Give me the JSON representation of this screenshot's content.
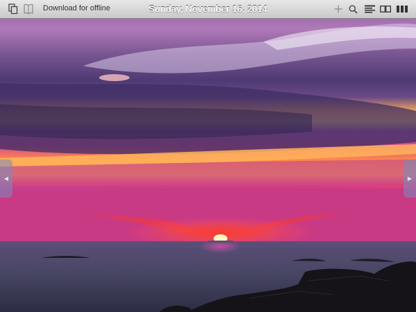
{
  "toolbar": {
    "download_label": "Download for offline",
    "date_title": "Sunday, November 16, 2014",
    "icons": {
      "left": [
        "pages-icon",
        "bookmark-icon"
      ],
      "right": [
        "add-icon",
        "search-icon",
        "list-icon",
        "two-page-icon",
        "columns-icon"
      ]
    }
  },
  "navigation": {
    "prev_glyph": "◀",
    "next_glyph": "▶"
  },
  "photo": {
    "subject": "sunset-over-sea",
    "colors": {
      "sky_top": "#7b4f8f",
      "cloud_purple": "#4e3570",
      "glow_orange": "#ff9a4a",
      "band_pink": "#d8358e",
      "sun": "#fff3b0",
      "sea": "#3e3f5e",
      "rocks": "#151318"
    }
  }
}
